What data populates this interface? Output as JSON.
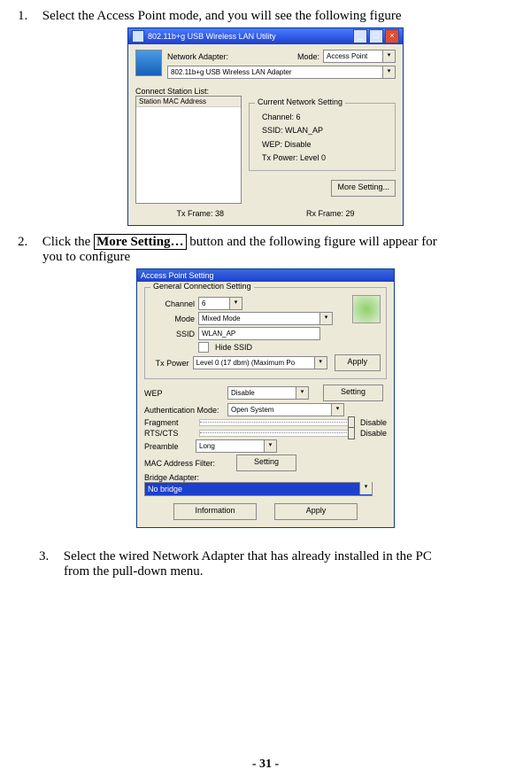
{
  "steps": {
    "s1_num": "1.",
    "s1a": "Select the Access Point mode, and you will see the following figure",
    "s2_num": "2.",
    "s2a": "Click the ",
    "s2_btn": "More Setting…",
    "s2b": " button and the following figure will appear for",
    "s2c": "you to configure",
    "s3_num": "3.",
    "s3a": "Select the wired Network Adapter that has already installed in the PC",
    "s3b": "from the pull-down menu."
  },
  "fig1": {
    "title": "802.11b+g USB Wireless LAN Utility",
    "min": "_",
    "max": "□",
    "close": "×",
    "adapter_lbl": "Network Adapter:",
    "adapter_val": "802.11b+g USB Wireless LAN Adapter",
    "mode_lbl": "Mode:",
    "mode_val": "Access Point",
    "connect_lbl": "Connect Station List:",
    "mac_hdr": "Station MAC Address",
    "grp_lbl": "Current Network Setting",
    "channel": "Channel:  6",
    "ssid": "SSID:  WLAN_AP",
    "wep": "WEP:  Disable",
    "txpower": "Tx Power:  Level 0",
    "more_btn": "More Setting...",
    "txframe": "Tx Frame:  38",
    "rxframe": "Rx Frame:  29",
    "dd": "▾"
  },
  "fig2": {
    "title": "Access Point Setting",
    "grp_lbl": "General Connection Setting",
    "channel_lbl": "Channel",
    "channel_val": "6",
    "mode_lbl": "Mode",
    "mode_val": "Mixed Mode",
    "ssid_lbl": "SSID",
    "ssid_val": "WLAN_AP",
    "hide_ssid": "Hide SSID",
    "txp_lbl": "Tx Power",
    "txp_val": "Level 0 (17 dbm) (Maximum Po",
    "apply": "Apply",
    "wep_lbl": "WEP",
    "wep_val": "Disable",
    "setting_btn": "Setting",
    "auth_lbl": "Authentication Mode:",
    "auth_val": "Open System",
    "frag_lbl": "Fragment",
    "rts_lbl": "RTS/CTS",
    "disable": "Disable",
    "preamble_lbl": "Preamble",
    "preamble_val": "Long",
    "macfilter_lbl": "MAC Address Filter:",
    "bridge_lbl": "Bridge Adapter:",
    "bridge_val": "No bridge",
    "info_btn": "Information",
    "dd": "▾"
  },
  "pagenum": "- 31 -"
}
